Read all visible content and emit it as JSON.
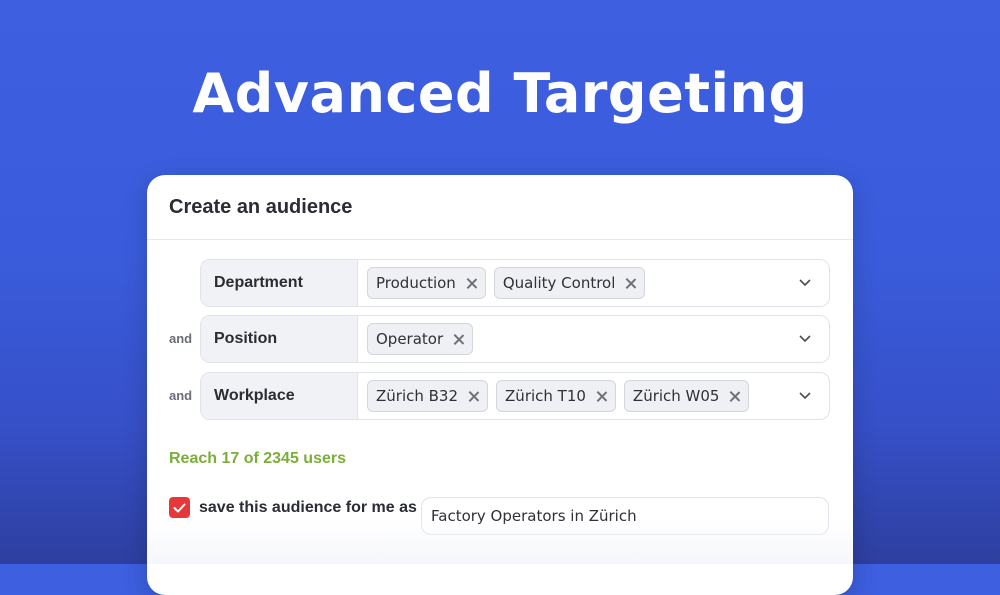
{
  "hero": {
    "title": "Advanced Targeting"
  },
  "card": {
    "title": "Create an audience",
    "filters": [
      {
        "joiner": "",
        "label": "Department",
        "chips": [
          "Production",
          "Quality Control"
        ]
      },
      {
        "joiner": "and",
        "label": "Position",
        "chips": [
          "Operator"
        ]
      },
      {
        "joiner": "and",
        "label": "Workplace",
        "chips": [
          "Zürich B32",
          "Zürich T10",
          "Zürich W05"
        ]
      }
    ],
    "reach_text": "Reach 17 of 2345 users",
    "save": {
      "checked": true,
      "label": "save this audience for me as",
      "value": "Factory Operators in Zürich"
    }
  },
  "colors": {
    "background": "#3d5fe0",
    "reach": "#7cae3a",
    "checkbox": "#e5383b"
  },
  "icons": {
    "chip_remove": "close-icon",
    "dropdown": "chevron-down-icon",
    "checkbox": "check-icon"
  }
}
